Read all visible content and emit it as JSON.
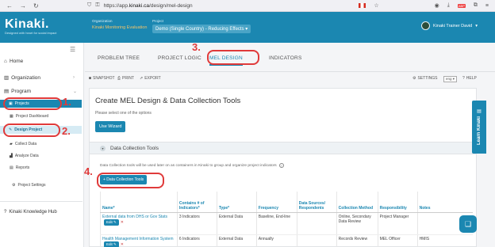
{
  "browser": {
    "url_prefix": "https://app.",
    "url_domain": "kinaki.ca",
    "url_path": "/design/mel-design"
  },
  "header": {
    "logo": "Kinaki.",
    "tagline": "Designed with heart for social impact",
    "org_label": "Organization",
    "org_name": "Kinaki Monitoring Evaluation",
    "proj_label": "Project",
    "project_name": "Demo (Single Country) - Reducing Effects",
    "user_name": "Kinaki Trainer David"
  },
  "sidebar": {
    "home": "Home",
    "organization": "Organization",
    "program": "Program",
    "projects": "Projects",
    "project_dashboard": "Project Dashboard",
    "design_project": "Design Project",
    "collect_data": "Collect Data",
    "analyze_data": "Analyze Data",
    "reports": "Reports",
    "project_settings": "Project Settings",
    "knowledge_hub": "Kinaki Knowledge Hub"
  },
  "tabs": [
    "PROBLEM TREE",
    "PROJECT LOGIC",
    "MEL DESIGN",
    "INDICATORS"
  ],
  "toolbar": {
    "snapshot": "SNAPSHOT",
    "print": "PRINT",
    "export": "EXPORT",
    "settings": "SETTINGS",
    "lang": "eng",
    "help": "HELP"
  },
  "main": {
    "title": "Create MEL Design & Data Collection Tools",
    "subtitle": "Please select one of the options",
    "use_wizard": "Use Wizard",
    "section_title": "Data Collection Tools",
    "section_desc": "Data Collection tools will be used later on as containers in Kinaki to group and organize project indicators",
    "add_tool_btn": "+ Data Collection Tools"
  },
  "table": {
    "headers": [
      "Name*",
      "Contains # of Indicators*",
      "Type*",
      "Frequency",
      "Data Sources/ Respondents",
      "Collection Method",
      "Responsibility",
      "Notes"
    ],
    "rows": [
      {
        "name": "External data from DHS or Gov Stats",
        "indicators": "3 Indicators",
        "type": "External Data",
        "frequency": "Baseline, End-line",
        "sources": "",
        "method": "Online, Secondary Data Review",
        "responsibility": "Project Manager",
        "notes": ""
      },
      {
        "name": "Health Management Information System",
        "indicators": "6 Indicators",
        "type": "External Data",
        "frequency": "Annually",
        "sources": "",
        "method": "Records Review",
        "responsibility": "MEL Officer",
        "notes": "HMIS"
      }
    ],
    "edit_label": "Edit"
  },
  "learn_tab": "Learn Kinaki",
  "annotations": [
    "1.",
    "2.",
    "3.",
    "4."
  ]
}
